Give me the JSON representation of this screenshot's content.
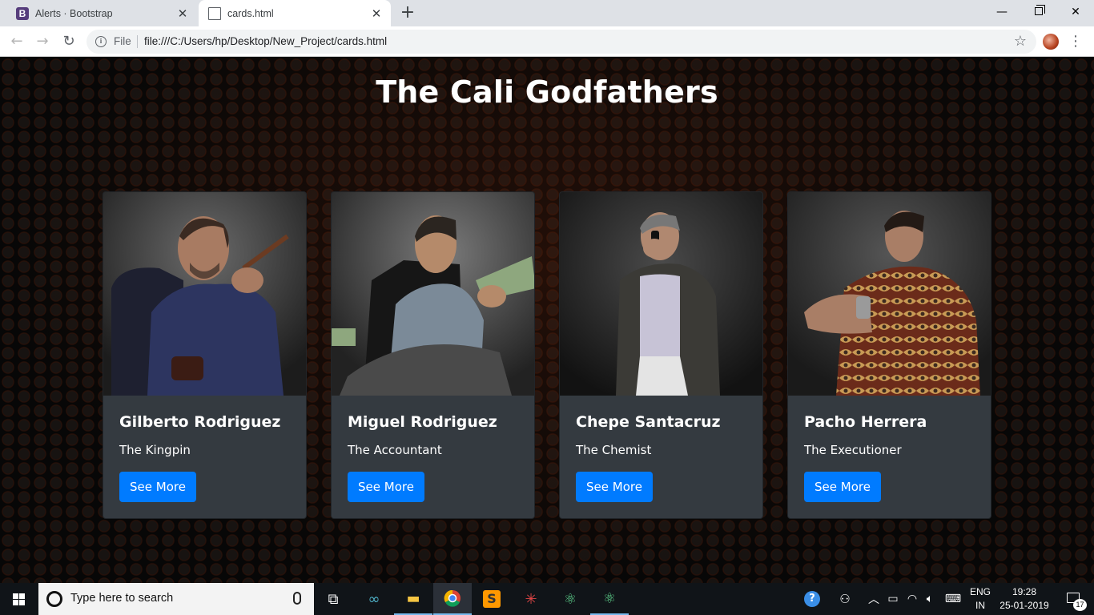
{
  "browser": {
    "tabs": [
      {
        "title": "Alerts · Bootstrap",
        "favicon": "bootstrap-icon",
        "active": false
      },
      {
        "title": "cards.html",
        "favicon": "document-icon",
        "active": true
      }
    ],
    "address": {
      "scheme_label": "File",
      "url": "file:///C:/Users/hp/Desktop/New_Project/cards.html"
    }
  },
  "page": {
    "title": "The Cali Godfathers",
    "cards": [
      {
        "name": "Gilberto Rodriguez",
        "role": "The Kingpin",
        "button": "See More"
      },
      {
        "name": "Miguel Rodriguez",
        "role": "The Accountant",
        "button": "See More"
      },
      {
        "name": "Chepe Santacruz",
        "role": "The Chemist",
        "button": "See More"
      },
      {
        "name": "Pacho Herrera",
        "role": "The Executioner",
        "button": "See More"
      }
    ],
    "colors": {
      "card_bg": "#343a40",
      "button_bg": "#007bff"
    }
  },
  "taskbar": {
    "search_placeholder": "Type here to search",
    "language": {
      "line1": "ENG",
      "line2": "IN"
    },
    "time": "19:28",
    "date": "25-01-2019",
    "notification_count": "17"
  }
}
